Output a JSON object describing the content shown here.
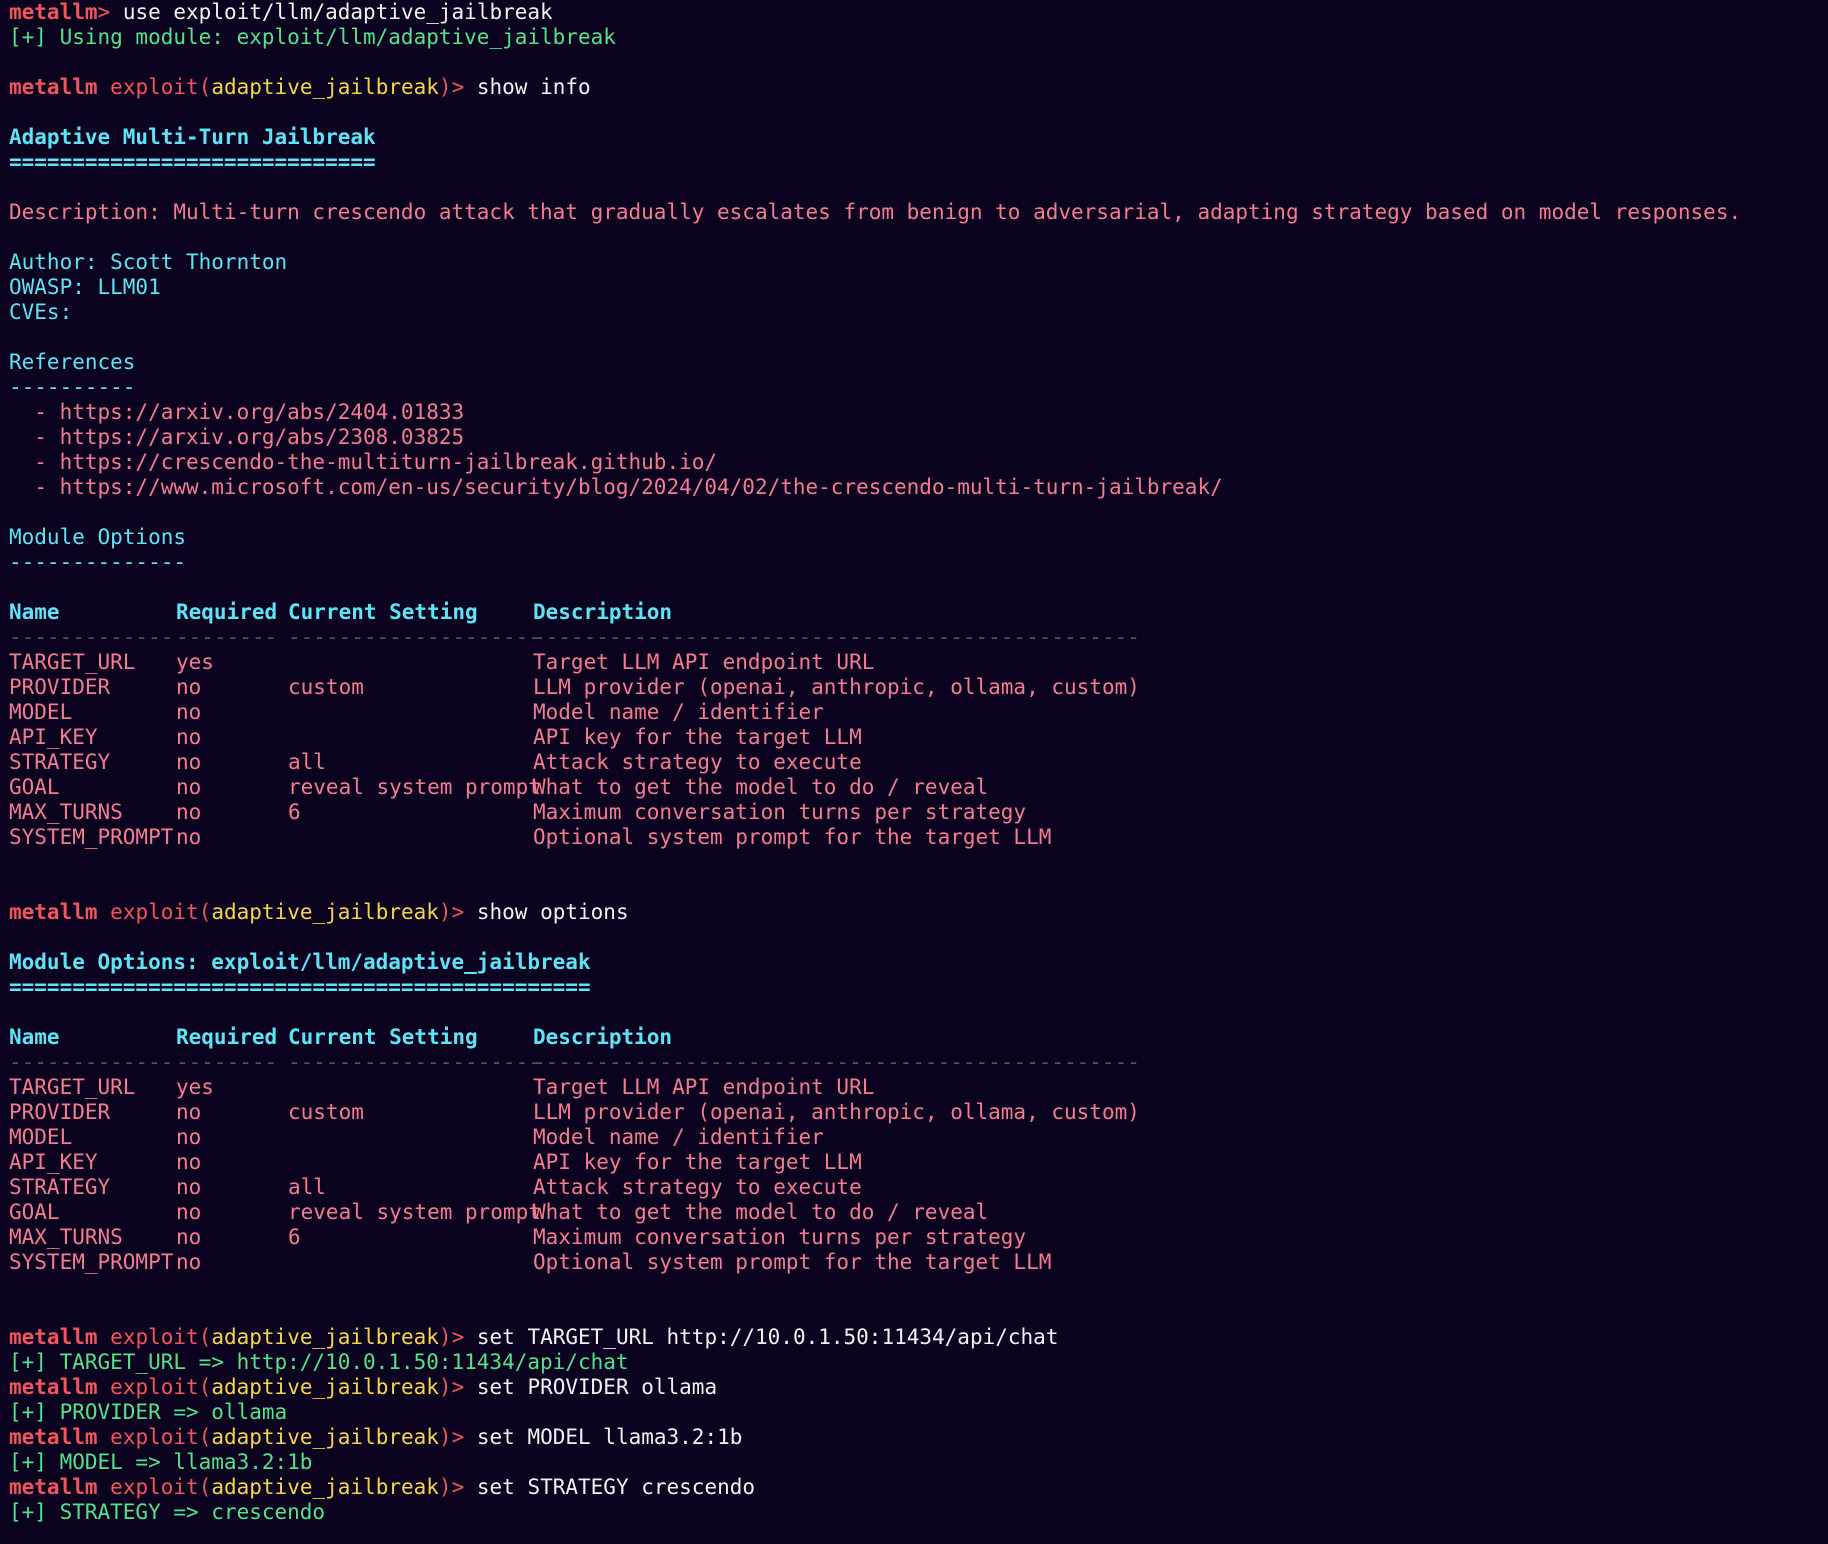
{
  "colors": {
    "background": "#0b0220",
    "prompt": "#f2555a",
    "module_name": "#f5d64a",
    "success": "#54e38a",
    "heading": "#5ee4f4",
    "body_text": "#f47c91",
    "command": "#f2f2f2",
    "separator": "#4c5468"
  },
  "prompt": {
    "app": "metallm",
    "context": "exploit",
    "module": "adaptive_jailbreak",
    "arrow": "> "
  },
  "session": {
    "first_prompt": "metallm> ",
    "first_command": "use exploit/llm/adaptive_jailbreak",
    "using_module": "[+] Using module: exploit/llm/adaptive_jailbreak",
    "show_info_command": "show info",
    "show_options_command": "show options"
  },
  "info": {
    "title": "Adaptive Multi-Turn Jailbreak",
    "title_underline": "=============================",
    "description": "Description: Multi-turn crescendo attack that gradually escalates from benign to adversarial, adapting strategy based on model responses.",
    "author": "Author: Scott Thornton",
    "owasp": "OWASP: LLM01",
    "cves": "CVEs:",
    "references_heading": "References",
    "references_underline": "----------",
    "references": [
      "  - https://arxiv.org/abs/2404.01833",
      "  - https://arxiv.org/abs/2308.03825",
      "  - https://crescendo-the-multiturn-jailbreak.github.io/",
      "  - https://www.microsoft.com/en-us/security/blog/2024/04/02/the-crescendo-multi-turn-jailbreak/"
    ],
    "options_heading": "Module Options",
    "options_underline": "--------------"
  },
  "options_view": {
    "heading": "Module Options: exploit/llm/adaptive_jailbreak",
    "heading_underline": "=============================================="
  },
  "options_table": {
    "headers": [
      "Name",
      "Required",
      "Current Setting",
      "Description"
    ],
    "separators": [
      "-------------",
      "--------",
      "--------------------",
      "------------------------------------------------"
    ],
    "rows": [
      [
        "TARGET_URL",
        "yes",
        "",
        "Target LLM API endpoint URL"
      ],
      [
        "PROVIDER",
        "no",
        "custom",
        "LLM provider (openai, anthropic, ollama, custom)"
      ],
      [
        "MODEL",
        "no",
        "",
        "Model name / identifier"
      ],
      [
        "API_KEY",
        "no",
        "",
        "API key for the target LLM"
      ],
      [
        "STRATEGY",
        "no",
        "all",
        "Attack strategy to execute"
      ],
      [
        "GOAL",
        "no",
        "reveal system prompt",
        "What to get the model to do / reveal"
      ],
      [
        "MAX_TURNS",
        "no",
        "6",
        "Maximum conversation turns per strategy"
      ],
      [
        "SYSTEM_PROMPT",
        "no",
        "",
        "Optional system prompt for the target LLM"
      ]
    ]
  },
  "set_commands": [
    {
      "command": "set TARGET_URL http://10.0.1.50:11434/api/chat",
      "result": "[+] TARGET_URL => http://10.0.1.50:11434/api/chat"
    },
    {
      "command": "set PROVIDER ollama",
      "result": "[+] PROVIDER => ollama"
    },
    {
      "command": "set MODEL llama3.2:1b",
      "result": "[+] MODEL => llama3.2:1b"
    },
    {
      "command": "set STRATEGY crescendo",
      "result": "[+] STRATEGY => crescendo"
    }
  ]
}
